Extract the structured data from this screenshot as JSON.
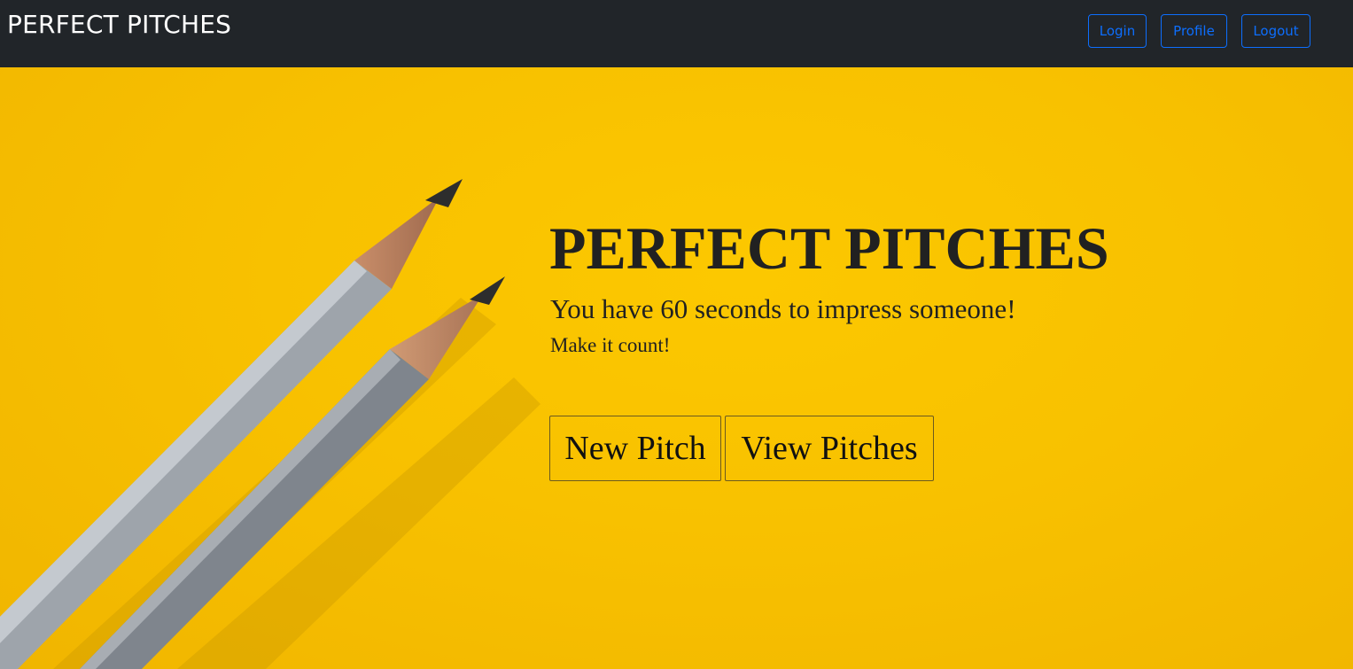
{
  "navbar": {
    "brand": "PERFECT PITCHES",
    "buttons": {
      "login": "Login",
      "profile": "Profile",
      "logout": "Logout"
    },
    "background": "#212529",
    "accent": "#0d6efd"
  },
  "hero": {
    "title": "PERFECT PITCHES",
    "subtitle": "You have 60 seconds to impress someone!",
    "tagline": "Make it count!",
    "buttons": {
      "new_pitch": "New Pitch",
      "view_pitches": "View Pitches"
    },
    "background": "#f8c100",
    "image": "pencils-illustration"
  }
}
